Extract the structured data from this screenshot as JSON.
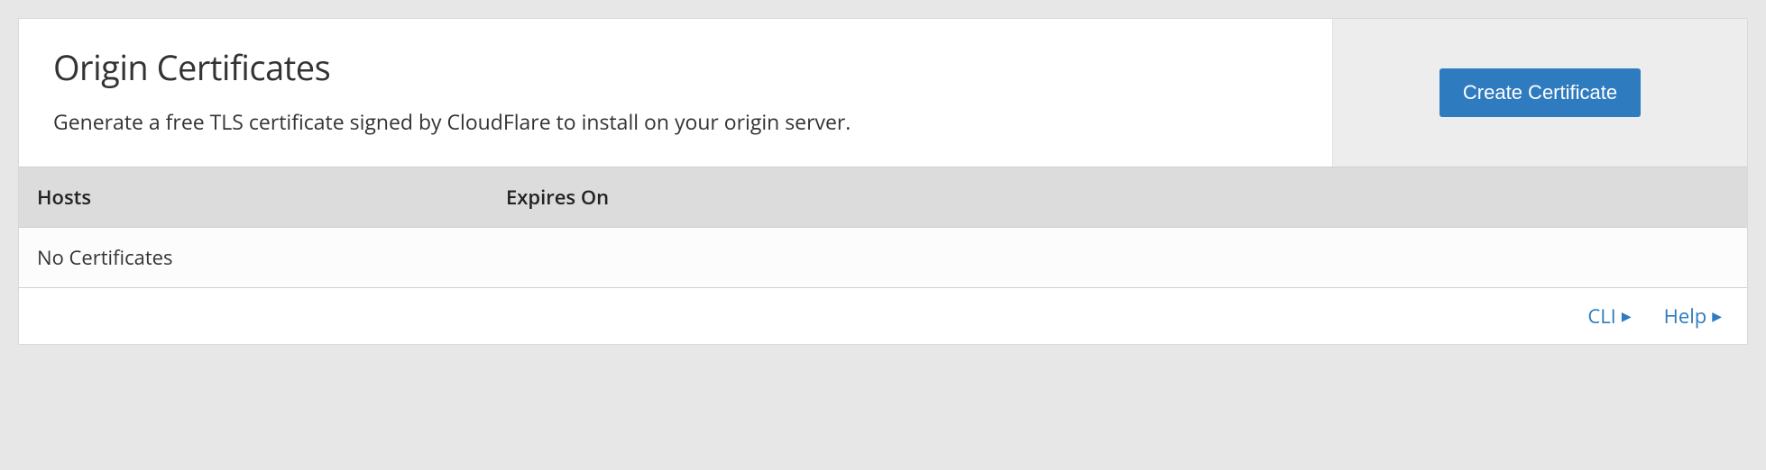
{
  "header": {
    "title": "Origin Certificates",
    "description": "Generate a free TLS certificate signed by CloudFlare to install on your origin server.",
    "create_button": "Create Certificate"
  },
  "table": {
    "columns": {
      "hosts": "Hosts",
      "expires_on": "Expires On"
    },
    "empty": "No Certificates"
  },
  "footer": {
    "cli": "CLI",
    "help": "Help"
  }
}
